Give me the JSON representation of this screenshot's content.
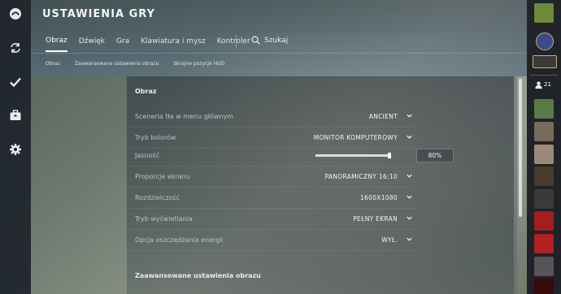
{
  "title": "USTAWIENIA GRY",
  "tabs": [
    {
      "label": "Obraz",
      "active": true
    },
    {
      "label": "Dźwięk"
    },
    {
      "label": "Gra"
    },
    {
      "label": "Klawiatura i mysz"
    },
    {
      "label": "Kontroler"
    }
  ],
  "search": {
    "label": "Szukaj",
    "icon": "search-icon"
  },
  "subtabs": [
    "Obraz",
    "Zaawansowane ustawienia obrazu",
    "Skrajne pozycje HUD"
  ],
  "section1": "Obraz",
  "settings": [
    {
      "label": "Sceneria tła w menu głównym",
      "value": "ANCIENT"
    },
    {
      "label": "Tryb kolorów",
      "value": "MONITOR KOMPUTEROWY"
    },
    {
      "label": "Jasność",
      "slider_value": "80%",
      "slider_fraction": 1.0
    },
    {
      "label": "Proporcje ekranu",
      "value": "PANORAMICZNY 16:10"
    },
    {
      "label": "Rozdzielczość",
      "value": "1600X1080"
    },
    {
      "label": "Tryb wyświetlania",
      "value": "PEŁNY EKRAN"
    },
    {
      "label": "Opcja oszczędzania energii",
      "value": "WYŁ."
    }
  ],
  "section2": "Zaawansowane ustawienia obrazu",
  "left_rail_icons": [
    "play-icon",
    "refresh-icon",
    "checkmark-icon",
    "briefcase-icon",
    "gear-icon"
  ],
  "right_rail": {
    "friends_count": "21",
    "avatar_colors": [
      "#6d8a3a",
      "#3a4a8a",
      "#8a6a2a",
      "#5a7a4a",
      "#7a6a5a",
      "#9a8a7a",
      "#4a3a2a",
      "#3a3a3a",
      "#a02020",
      "#b02020",
      "#555555",
      "#3a0a0a"
    ]
  },
  "colors": {
    "accent": "#ffffff",
    "panel": "#2a323c"
  }
}
